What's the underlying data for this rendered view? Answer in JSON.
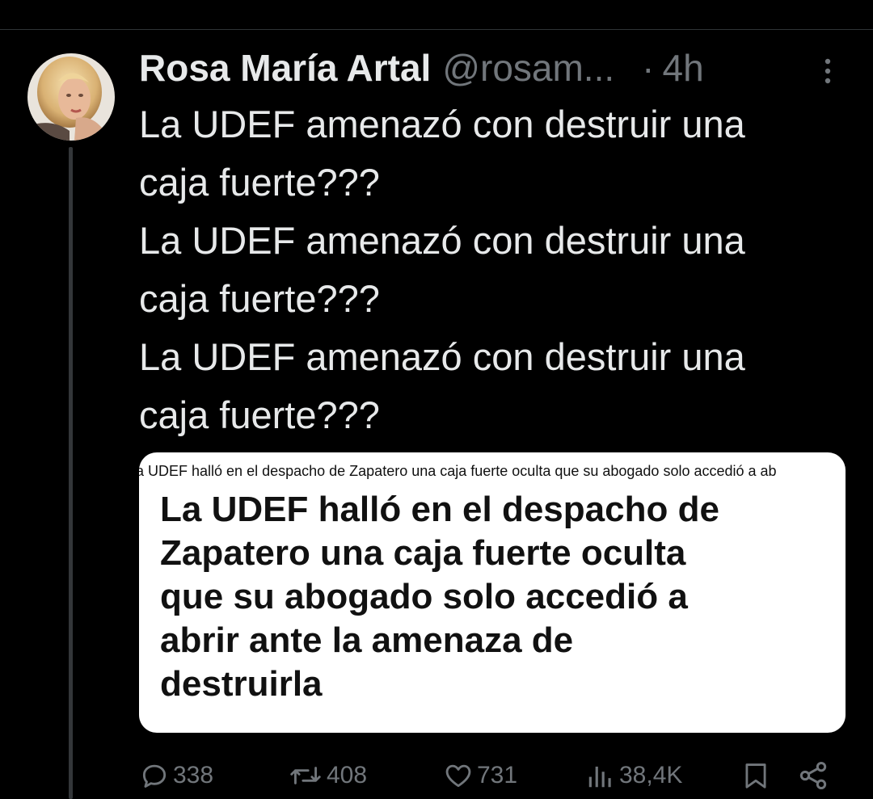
{
  "tweet": {
    "author_name": "Rosa María Artal",
    "author_handle": "@rosam...",
    "separator": "·",
    "timestamp": "4h",
    "text_lines": [
      "La UDEF amenazó con destruir una",
      "caja fuerte???",
      "La UDEF amenazó con destruir una",
      "caja fuerte???",
      "La UDEF amenazó con destruir una",
      "caja fuerte???"
    ]
  },
  "media": {
    "caption": "a UDEF halló en el despacho de Zapatero una caja fuerte oculta que su abogado solo accedió a ab",
    "headline_lines": [
      "La UDEF halló en el despacho de",
      "Zapatero una caja fuerte oculta",
      "que su abogado solo accedió a",
      "abrir ante la amenaza de",
      "destruirla"
    ]
  },
  "actions": {
    "replies": "338",
    "retweets": "408",
    "likes": "731",
    "views": "38,4K"
  },
  "icons": {
    "avatar": "avatar-photo",
    "more": "more-vertical-icon",
    "reply": "reply-icon",
    "retweet": "retweet-icon",
    "like": "heart-icon",
    "views": "views-icon",
    "bookmark": "bookmark-icon",
    "share": "share-icon"
  },
  "colors": {
    "background": "#000000",
    "text_primary": "#e7e9ea",
    "text_secondary": "#71767b",
    "divider": "#2f3336",
    "card_background": "#ffffff"
  }
}
